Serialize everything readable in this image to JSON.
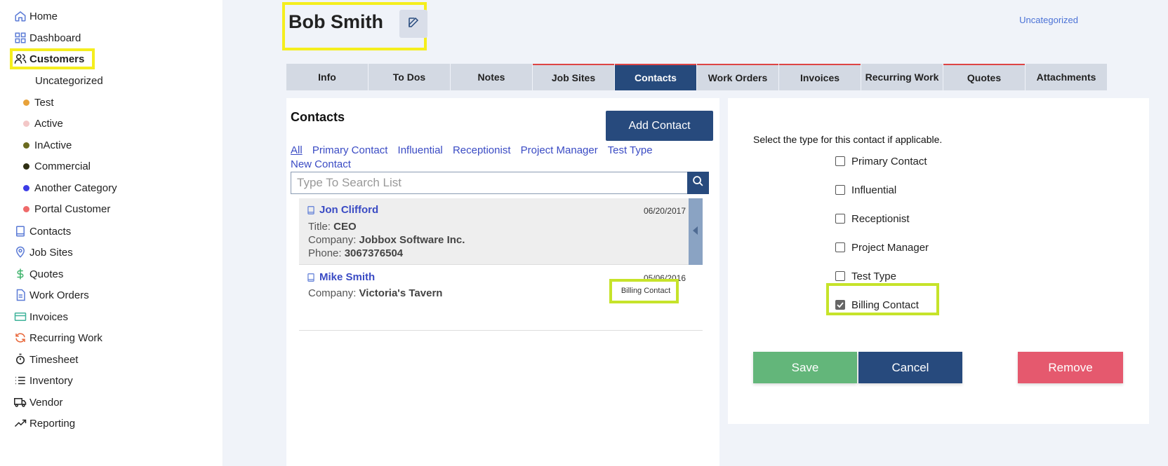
{
  "sidebar": {
    "items": [
      {
        "label": "Home",
        "icon": "home-icon"
      },
      {
        "label": "Dashboard",
        "icon": "dashboard-icon"
      },
      {
        "label": "Customers",
        "icon": "users-icon"
      },
      {
        "label": "Contacts",
        "icon": "book-icon"
      },
      {
        "label": "Job Sites",
        "icon": "map-pin-icon"
      },
      {
        "label": "Quotes",
        "icon": "dollar-icon"
      },
      {
        "label": "Work Orders",
        "icon": "document-icon"
      },
      {
        "label": "Invoices",
        "icon": "credit-card-icon"
      },
      {
        "label": "Recurring Work",
        "icon": "refresh-icon"
      },
      {
        "label": "Timesheet",
        "icon": "stopwatch-icon"
      },
      {
        "label": "Inventory",
        "icon": "list-icon"
      },
      {
        "label": "Vendor",
        "icon": "truck-icon"
      },
      {
        "label": "Reporting",
        "icon": "trend-icon"
      }
    ],
    "categories": [
      {
        "label": "Uncategorized",
        "color": ""
      },
      {
        "label": "Test",
        "color": "#e8a23a"
      },
      {
        "label": "Active",
        "color": "#f3c7c7"
      },
      {
        "label": "InActive",
        "color": "#6b6b1f"
      },
      {
        "label": "Commercial",
        "color": "#2e2e12"
      },
      {
        "label": "Another Category",
        "color": "#3c3ce6"
      },
      {
        "label": "Portal Customer",
        "color": "#ef6a6a"
      }
    ]
  },
  "header": {
    "title": "Bob Smith",
    "category_link": "Uncategorized"
  },
  "tabs": [
    "Info",
    "To Dos",
    "Notes",
    "Job Sites",
    "Contacts",
    "Work Orders",
    "Invoices",
    "Recurring Work",
    "Quotes",
    "Attachments"
  ],
  "contacts": {
    "title": "Contacts",
    "add_label": "Add Contact",
    "filters": [
      "All",
      "Primary Contact",
      "Influential",
      "Receptionist",
      "Project Manager",
      "Test Type",
      "New Contact"
    ],
    "search_placeholder": "Type To Search List",
    "list": [
      {
        "name": "Jon Clifford",
        "date": "06/20/2017",
        "title_label": "Title:",
        "title_value": "CEO",
        "company_label": "Company:",
        "company_value": "Jobbox Software Inc.",
        "phone_label": "Phone:",
        "phone_value": "3067376504"
      },
      {
        "name": "Mike Smith",
        "date": "05/06/2016",
        "company_label": "Company:",
        "company_value": "Victoria's Tavern",
        "badge": "Billing Contact"
      }
    ]
  },
  "type_panel": {
    "prompt": "Select the type for this contact if applicable.",
    "options": [
      {
        "label": "Primary Contact",
        "checked": false
      },
      {
        "label": "Influential",
        "checked": false
      },
      {
        "label": "Receptionist",
        "checked": false
      },
      {
        "label": "Project Manager",
        "checked": false
      },
      {
        "label": "Test Type",
        "checked": false
      },
      {
        "label": "Billing Contact",
        "checked": true
      }
    ],
    "save_label": "Save",
    "cancel_label": "Cancel",
    "remove_label": "Remove"
  },
  "colors": {
    "accent": "#274a7d",
    "link": "#3a4bc4",
    "save": "#63b67a",
    "remove": "#e5596e",
    "highlight_yellow": "#f5ee1e",
    "highlight_green": "#c6e32a"
  }
}
